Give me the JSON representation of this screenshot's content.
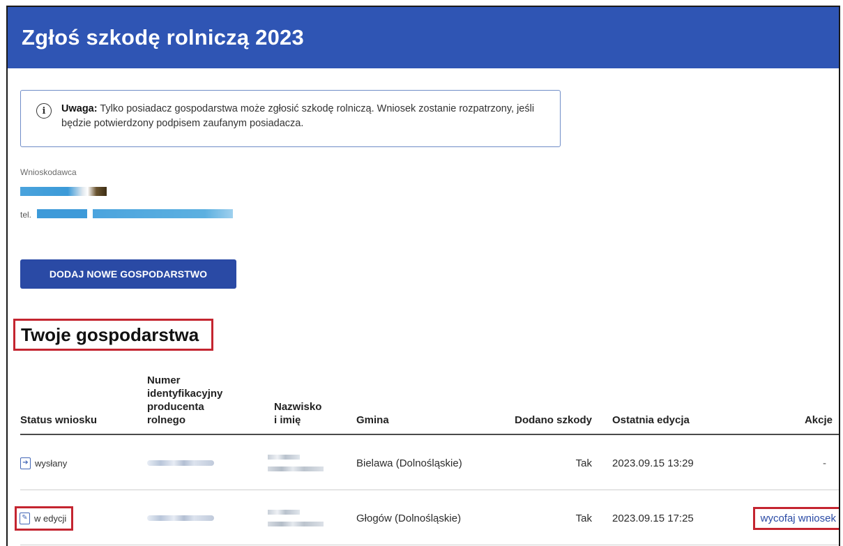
{
  "header": {
    "title": "Zgłoś szkodę rolniczą 2023"
  },
  "notice": {
    "icon": "info-icon",
    "bold_label": "Uwaga:",
    "text": " Tylko posiadacz gospodarstwa może zgłosić szkodę rolniczą. Wniosek zostanie rozpatrzony, jeśli będzie potwierdzony podpisem zaufanym posiadacza."
  },
  "applicant": {
    "label": "Wnioskodawca",
    "phone_label": "tel."
  },
  "add_button": {
    "label": "DODAJ NOWE GOSPODARSTWO"
  },
  "section": {
    "title": "Twoje gospodarstwa"
  },
  "table": {
    "headers": {
      "status": "Status wniosku",
      "id_line1": "Numer",
      "id_line2": "identyfikacyjny",
      "id_line3": "producenta",
      "id_line4": "rolnego",
      "name_line1": "Nazwisko",
      "name_line2": "i imię",
      "gmina": "Gmina",
      "dodano": "Dodano szkody",
      "edycja": "Ostatnia edycja",
      "akcje": "Akcje"
    },
    "rows": [
      {
        "status": "wysłany",
        "status_icon": "send-icon",
        "gmina": "Bielawa (Dolnośląskie)",
        "dodano": "Tak",
        "edycja": "2023.09.15 13:29",
        "akcje": "-"
      },
      {
        "status": "w edycji",
        "status_icon": "edit-document-icon",
        "gmina": "Głogów (Dolnośląskie)",
        "dodano": "Tak",
        "edycja": "2023.09.15 17:25",
        "akcje": "wycofaj wniosek"
      }
    ]
  },
  "colors": {
    "banner": "#2f55b4",
    "button": "#2a4aa5",
    "highlight": "#c42530",
    "link": "#2a4aa5"
  }
}
